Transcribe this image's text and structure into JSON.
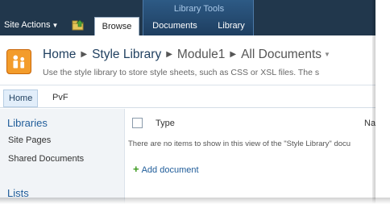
{
  "ribbon": {
    "site_actions_label": "Site Actions",
    "contextual_group_label": "Library Tools",
    "tabs": [
      {
        "label": "Browse",
        "selected": true
      },
      {
        "label": "Documents"
      },
      {
        "label": "Library"
      }
    ]
  },
  "title_area": {
    "breadcrumb": [
      "Home",
      "Style Library",
      "Module1",
      "All Documents"
    ],
    "description": "Use the style library to store style sheets, such as CSS or XSL files. The s"
  },
  "top_nav": {
    "items": [
      {
        "label": "Home",
        "selected": true
      },
      {
        "label": "PvF"
      }
    ]
  },
  "quick_launch": {
    "heading_libraries": "Libraries",
    "items": [
      "Site Pages",
      "Shared Documents"
    ],
    "heading_lists": "Lists"
  },
  "list_view": {
    "columns": [
      "Type",
      "Nam"
    ],
    "empty_message": "There are no items to show in this view of the \"Style Library\" docu",
    "add_document_label": "Add document"
  },
  "colors": {
    "ribbon_bg": "#21374c",
    "link_blue": "#1f5c99",
    "site_icon_orange": "#f39c2b"
  }
}
